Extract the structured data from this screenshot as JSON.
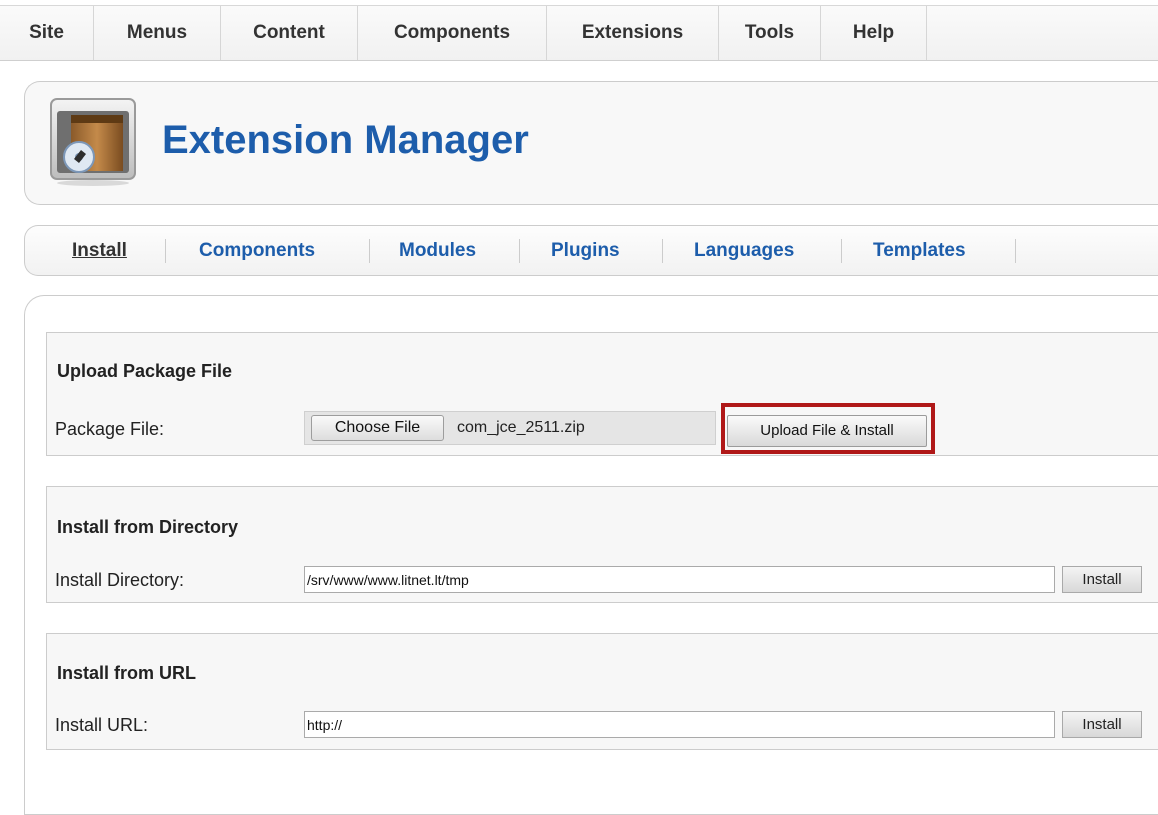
{
  "top_menu": {
    "items": [
      "Site",
      "Menus",
      "Content",
      "Components",
      "Extensions",
      "Tools",
      "Help"
    ]
  },
  "header": {
    "title": "Extension Manager",
    "icon": "extension-manager-icon"
  },
  "submenu": {
    "items": [
      "Install",
      "Components",
      "Modules",
      "Plugins",
      "Languages",
      "Templates"
    ],
    "active": "Install"
  },
  "upload_package": {
    "legend": "Upload Package File",
    "label": "Package File:",
    "choose_button": "Choose File",
    "file_name": "com_jce_2511.zip",
    "upload_button": "Upload File & Install",
    "highlight_color": "#b01818"
  },
  "install_directory": {
    "legend": "Install from Directory",
    "label": "Install Directory:",
    "value": "/srv/www/www.litnet.lt/tmp",
    "button": "Install"
  },
  "install_url": {
    "legend": "Install from URL",
    "label": "Install URL:",
    "value": "http://",
    "button": "Install"
  },
  "colors": {
    "link": "#1d5dab",
    "border": "#cccccc"
  }
}
